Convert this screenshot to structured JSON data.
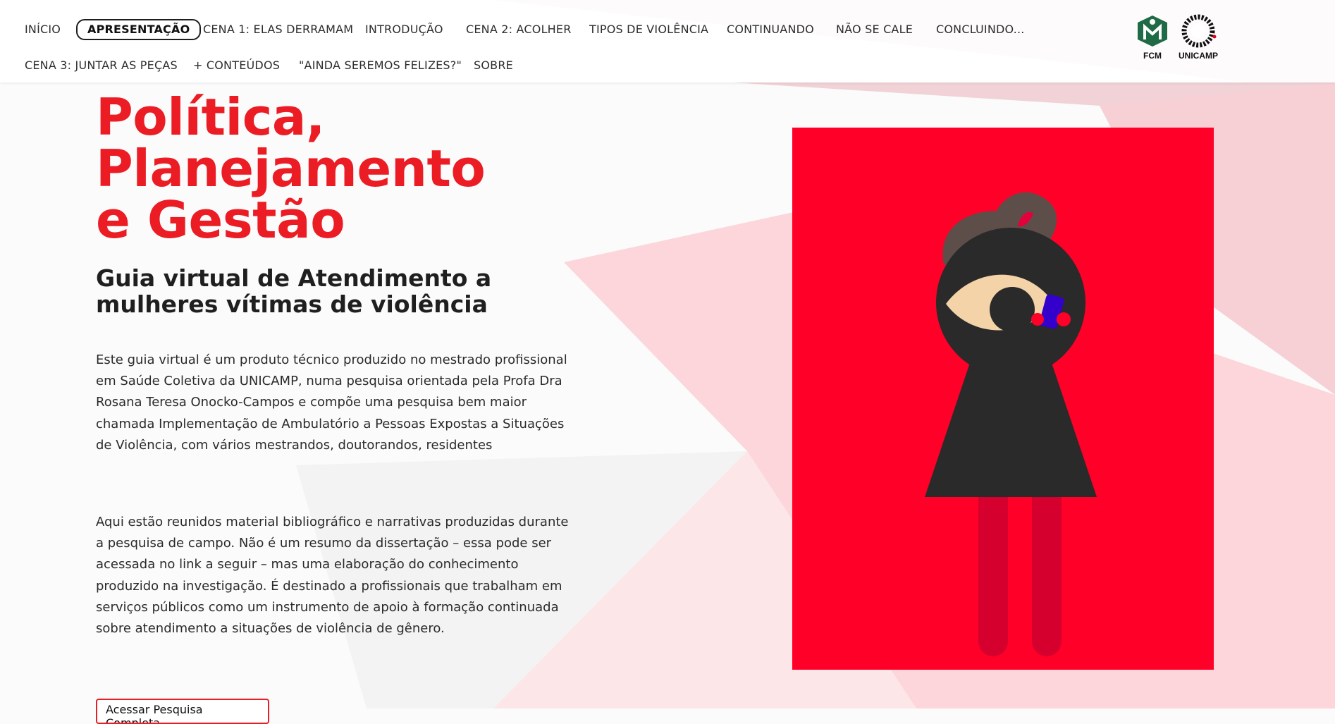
{
  "colors": {
    "brand_red": "#ec1c24",
    "illustration_bg": "#ff0028",
    "figure_dark": "#2a2a2a",
    "hair": "#5e4e4a",
    "eye_skin": "#f4d3a9",
    "legs": "#d6002e",
    "phone": "#3300cc"
  },
  "nav": {
    "items": [
      {
        "label": "INÍCIO"
      },
      {
        "label": "APRESENTAÇÃO",
        "active": true
      },
      {
        "label": "CENA 1: ELAS DERRAMAM"
      },
      {
        "label": "INTRODUÇÃO"
      },
      {
        "label": "CENA 2: ACOLHER"
      },
      {
        "label": "TIPOS DE VIOLÊNCIA"
      },
      {
        "label": "CONTINUANDO"
      },
      {
        "label": "NÃO SE CALE"
      },
      {
        "label": "CONCLUINDO..."
      },
      {
        "label": "CENA 3: JUNTAR AS PEÇAS"
      },
      {
        "label": "+ CONTEÚDOS"
      },
      {
        "label": "\"AINDA SEREMOS FELIZES?\""
      },
      {
        "label": "SOBRE"
      }
    ]
  },
  "logos": {
    "fcm": {
      "text": "FCM",
      "icon": "fcm-logo-icon"
    },
    "unicamp": {
      "text": "UNICAMP",
      "icon": "unicamp-logo-icon"
    }
  },
  "hero": {
    "title_lines": [
      "Política,",
      "Planejamento",
      "e Gestão"
    ],
    "subtitle_lines": [
      "Guia virtual de Atendimento a",
      "mulheres vítimas de violência"
    ],
    "paragraph1": "Este guia virtual é um produto técnico produzido no mestrado profissional em Saúde Coletiva da UNICAMP, numa pesquisa orientada pela Profa Dra Rosana Teresa Onocko-Campos e compõe uma pesquisa bem maior chamada Implementação de Ambulatório a Pessoas Expostas a Situações de Violência, com vários mestrandos, doutorandos, residentes",
    "paragraph2": "Aqui estão reunidos material bibliográfico e narrativas produzidas durante a pesquisa de campo. Não é um resumo da dissertação – essa pode ser acessada no link a seguir – mas uma elaboração do conhecimento produzido na investigação. É destinado a profissionais que trabalham em serviços públicos como um instrumento de apoio à formação continuada sobre atendimento a situações de violência de gênero.",
    "button_label": "Acessar Pesquisa Completa"
  },
  "illustration": {
    "icon": "woman-with-phone-illustration"
  }
}
